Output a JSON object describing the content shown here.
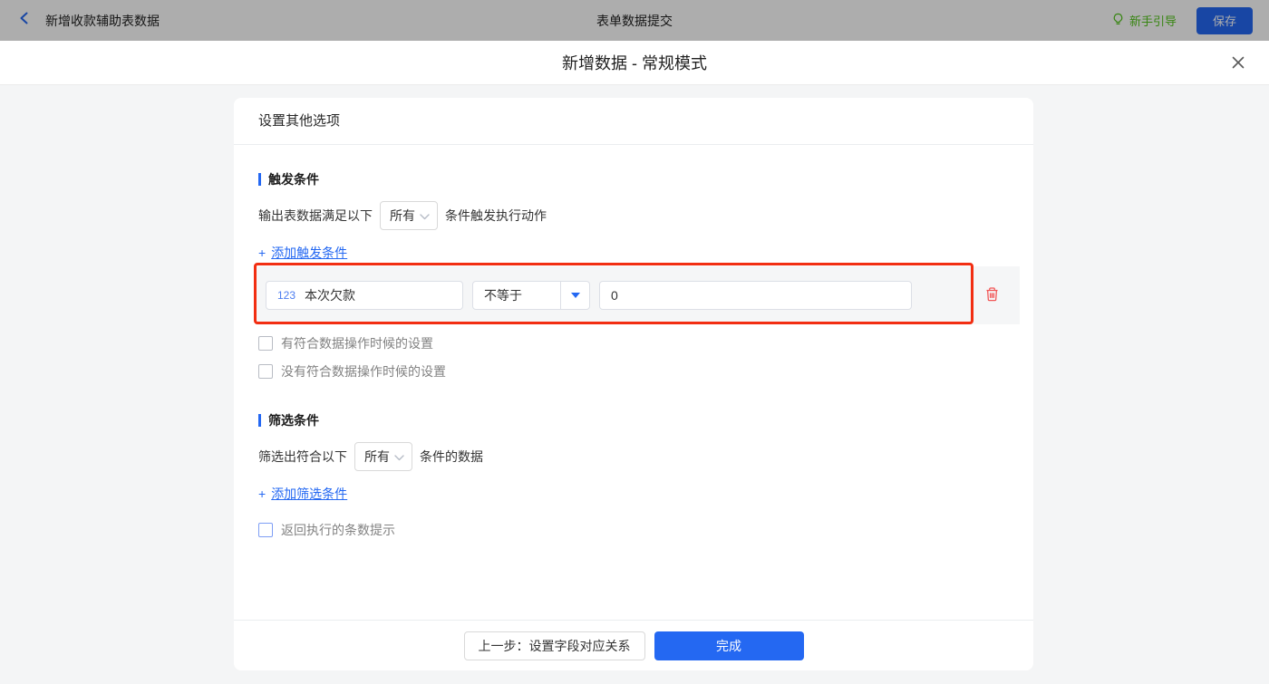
{
  "topbar": {
    "back_label": "新增收款辅助表数据",
    "title": "表单数据提交",
    "guide_label": "新手引导",
    "save_label": "保存"
  },
  "dialog": {
    "title": "新增数据 - 常规模式"
  },
  "panel": {
    "header": "设置其他选项",
    "trigger": {
      "title": "触发条件",
      "prefix": "输出表数据满足以下",
      "mode": "所有",
      "suffix": "条件触发执行动作",
      "add_plus": "+",
      "add_label": "添加触发条件",
      "condition": {
        "field_type_icon": "123",
        "field": "本次欠款",
        "operator": "不等于",
        "value": "0"
      },
      "checkbox_has": "有符合数据操作时候的设置",
      "checkbox_none": "没有符合数据操作时候的设置"
    },
    "filter": {
      "title": "筛选条件",
      "prefix": "筛选出符合以下",
      "mode": "所有",
      "suffix": "条件的数据",
      "add_plus": "+",
      "add_label": "添加筛选条件",
      "checkbox_tip": "返回执行的条数提示"
    },
    "footer": {
      "prev": "上一步：设置字段对应关系",
      "done": "完成"
    }
  },
  "colors": {
    "accent_blue": "#2468f2",
    "highlight_red": "#f22e12",
    "delete_red": "#f25555",
    "guide_green": "#52c41a",
    "row_gray": "#f5f6f7"
  }
}
